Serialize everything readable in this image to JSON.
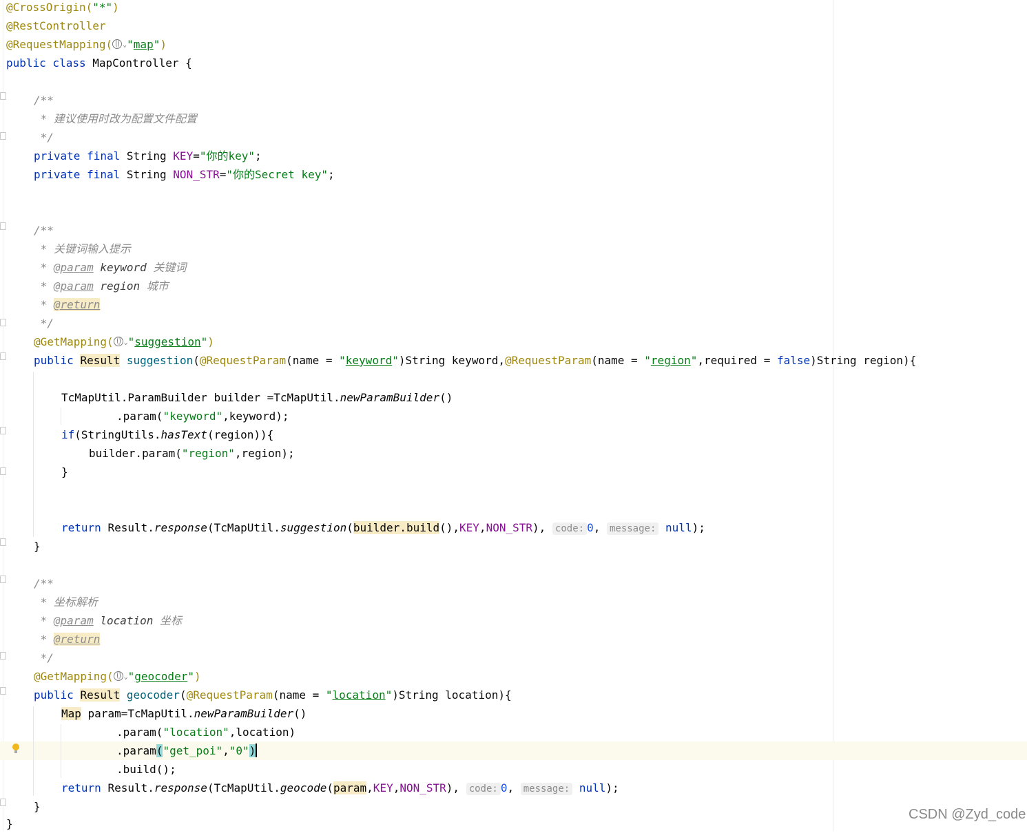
{
  "lines": [
    {
      "y": 0,
      "segments": [
        {
          "t": "@CrossOrigin(",
          "c": "ann"
        },
        {
          "t": "\"*\"",
          "c": "str"
        },
        {
          "t": ")",
          "c": ""
        }
      ]
    }
  ],
  "code": {
    "l1a": "@CrossOrigin(",
    "l1b": "\"*\"",
    "l1c": ")",
    "l2": "@RestController",
    "l3a": "@RequestMapping(",
    "l3q1": "\"",
    "l3b": "map",
    "l3q2": "\"",
    "l3c": ")",
    "l4a": "public class ",
    "l4b": "MapController {",
    "c1a": "/**",
    "c1b": " * 建议使用时改为配置文件配置",
    "c1c": " */",
    "f1a": "private final ",
    "f1b": "String ",
    "f1c": "KEY",
    "f1d": "=",
    "f1e": "\"你的key\"",
    "f1f": ";",
    "f2a": "private final ",
    "f2b": "String ",
    "f2c": "NON_STR",
    "f2d": "=",
    "f2e": "\"你的Secret key\"",
    "f2f": ";",
    "c2a": "/**",
    "c2b": " * 关键词输入提示",
    "c2c1": " * ",
    "c2c2": "@param",
    "c2c3": " keyword",
    "c2c4": " 关键词",
    "c2d1": " * ",
    "c2d2": "@param",
    "c2d3": " region",
    "c2d4": " 城市",
    "c2e1": " * ",
    "c2e2": "@return",
    "c2f": " */",
    "g1a": "@GetMapping(",
    "g1q1": "\"",
    "g1b": "suggestion",
    "g1q2": "\"",
    "g1c": ")",
    "m1a": "public ",
    "m1b": "Result",
    "m1c": " ",
    "m1d": "suggestion",
    "m1e": "(",
    "m1f": "@RequestParam",
    "m1g": "(name = ",
    "m1q1": "\"",
    "m1h": "keyword",
    "m1q2": "\"",
    "m1i": ")String keyword,",
    "m1j": "@RequestParam",
    "m1k": "(name = ",
    "m1q3": "\"",
    "m1l": "region",
    "m1q4": "\"",
    "m1m": ",required = ",
    "m1n": "false",
    "m1o": ")String region){",
    "b1a": "TcMapUtil.ParamBuilder builder =TcMapUtil.",
    "b1b": "newParamBuilder",
    "b1c": "()",
    "b2a": ".param(",
    "b2b": "\"keyword\"",
    "b2c": ",keyword);",
    "i1a": "if",
    "i1b": "(StringUtils.",
    "i1c": "hasText",
    "i1d": "(region)){",
    "i2a": "builder.param(",
    "i2b": "\"region\"",
    "i2c": ",region);",
    "i3": "}",
    "r1a": "return ",
    "r1b": "Result.",
    "r1c": "response",
    "r1d": "(TcMapUtil.",
    "r1e": "suggestion",
    "r1f": "(",
    "r1g": "builder.build",
    "r1h": "(),",
    "r1i": "KEY",
    "r1j": ",",
    "r1k": "NON_STR",
    "r1l": "), ",
    "r1m": "code:",
    "r1n": "0",
    "r1o": ", ",
    "r1p": "message:",
    "r1q": " null",
    "r1r": ");",
    "e1": "}",
    "c3a": "/**",
    "c3b": " * 坐标解析",
    "c3c1": " * ",
    "c3c2": "@param",
    "c3c3": " location",
    "c3c4": " 坐标",
    "c3d1": " * ",
    "c3d2": "@return",
    "c3e": " */",
    "g2a": "@GetMapping(",
    "g2q1": "\"",
    "g2b": "geocoder",
    "g2q2": "\"",
    "g2c": ")",
    "m2a": "public ",
    "m2b": "Result",
    "m2c": " ",
    "m2d": "geocoder",
    "m2e": "(",
    "m2f": "@RequestParam",
    "m2g": "(name = ",
    "m2q1": "\"",
    "m2h": "location",
    "m2q2": "\"",
    "m2i": ")String location){",
    "p1a": "Map",
    "p1b": " param=TcMapUtil.",
    "p1c": "newParamBuilder",
    "p1d": "()",
    "p2a": ".param(",
    "p2b": "\"location\"",
    "p2c": ",location)",
    "p3a": ".param",
    "p3b": "(",
    "p3c": "\"get_poi\"",
    "p3d": ",",
    "p3e": "\"0\"",
    "p3f": ")",
    "p4": ".build();",
    "r2a": "return ",
    "r2b": "Result.",
    "r2c": "response",
    "r2d": "(TcMapUtil.",
    "r2e": "geocode",
    "r2f": "(",
    "r2g": "param",
    "r2h": ",",
    "r2i": "KEY",
    "r2j": ",",
    "r2k": "NON_STR",
    "r2l": "), ",
    "r2m": "code:",
    "r2n": "0",
    "r2o": ", ",
    "r2p": "message:",
    "r2q": " null",
    "r2r": ");",
    "e2": "}",
    "e3": "}"
  },
  "watermark": "CSDN @Zyd_code",
  "colors": {
    "annotation": "#9e880d",
    "keyword": "#0033b3",
    "string": "#067d17",
    "comment": "#8c8c8c",
    "field": "#871094",
    "method": "#00627a",
    "highlight": "#f8ecc6",
    "current_line": "#fcfaed"
  }
}
